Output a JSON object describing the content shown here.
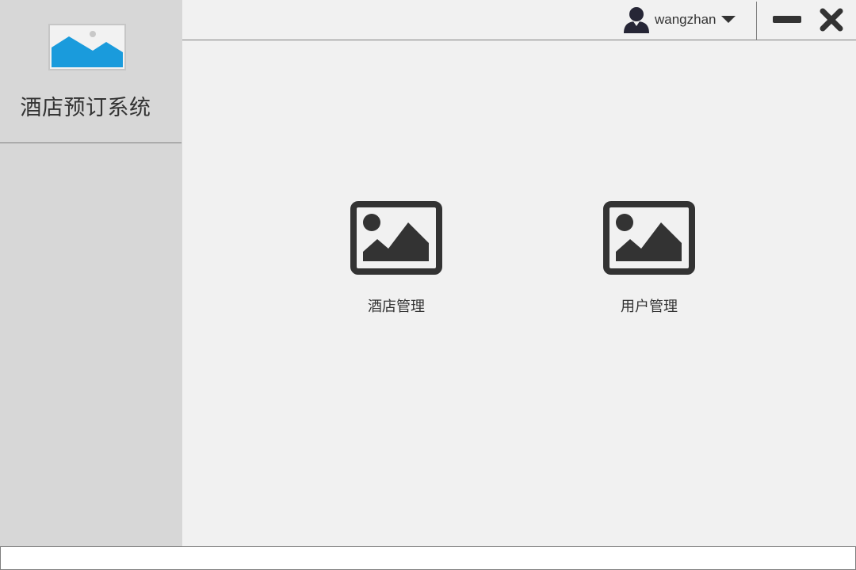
{
  "app": {
    "title": "酒店预订系统",
    "logo_icon": "image-placeholder-icon"
  },
  "header": {
    "username": "wangzhan",
    "user_icon": "user-avatar-icon",
    "dropdown_icon": "caret-down-icon",
    "minimize_icon": "minimize-icon",
    "close_icon": "close-icon"
  },
  "main": {
    "tiles": [
      {
        "label": "酒店管理",
        "icon": "image-icon"
      },
      {
        "label": "用户管理",
        "icon": "image-icon"
      }
    ]
  },
  "colors": {
    "sidebar_bg": "#d7d7d7",
    "main_bg": "#f1f1f1",
    "icon_dark": "#333333",
    "logo_blue": "#1a9bdc",
    "status_bar_bg": "#ffffff"
  }
}
